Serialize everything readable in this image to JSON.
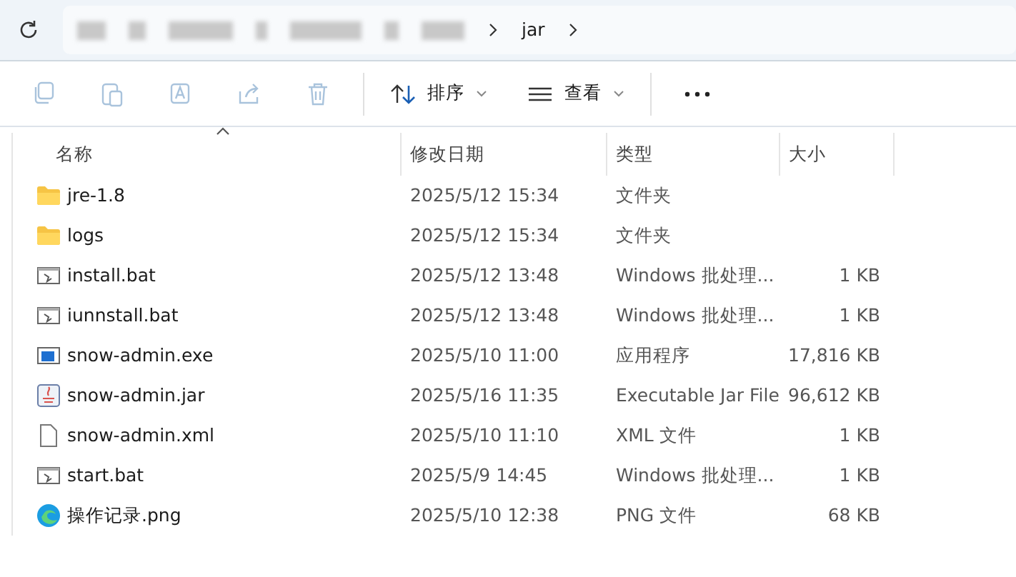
{
  "address": {
    "crumbs": [
      {
        "kind": "redacted"
      },
      {
        "kind": "folder",
        "label": "jar"
      }
    ]
  },
  "toolbar": {
    "actions": [
      {
        "kind": "copy",
        "disabled": true
      },
      {
        "kind": "paste",
        "disabled": true
      },
      {
        "kind": "rename",
        "disabled": true
      },
      {
        "kind": "share",
        "disabled": true
      },
      {
        "kind": "delete",
        "disabled": true
      }
    ],
    "sort": {
      "label": "排序"
    },
    "view": {
      "label": "查看"
    }
  },
  "table": {
    "columns": [
      {
        "label": "名称",
        "sorted": true
      },
      {
        "label": "修改日期",
        "sorted": false
      },
      {
        "label": "类型",
        "sorted": false
      },
      {
        "label": "大小",
        "sorted": false
      }
    ],
    "rows": [
      {
        "kind": "folder",
        "name": "jre-1.8",
        "date": "2025/5/12 15:34",
        "type": "文件夹"
      },
      {
        "kind": "folder",
        "name": "logs",
        "date": "2025/5/12 15:34",
        "type": "文件夹"
      },
      {
        "kind": "batch",
        "name": "install.bat",
        "date": "2025/5/12 13:48",
        "type": "Windows 批处理...",
        "size": "1 KB"
      },
      {
        "kind": "batch",
        "name": "iunnstall.bat",
        "date": "2025/5/12 13:48",
        "type": "Windows 批处理...",
        "size": "1 KB"
      },
      {
        "kind": "exe",
        "name": "snow-admin.exe",
        "date": "2025/5/10 11:00",
        "type": "应用程序",
        "size": "17,816 KB"
      },
      {
        "kind": "jar",
        "name": "snow-admin.jar",
        "date": "2025/5/16 11:35",
        "type": "Executable Jar File",
        "size": "96,612 KB"
      },
      {
        "kind": "file",
        "name": "snow-admin.xml",
        "date": "2025/5/10 11:10",
        "type": "XML 文件",
        "size": "1 KB"
      },
      {
        "kind": "batch",
        "name": "start.bat",
        "date": "2025/5/9 14:45",
        "type": "Windows 批处理...",
        "size": "1 KB"
      },
      {
        "kind": "image",
        "name": "操作记录.png",
        "date": "2025/5/10 12:38",
        "type": "PNG 文件",
        "size": "68 KB"
      }
    ]
  }
}
